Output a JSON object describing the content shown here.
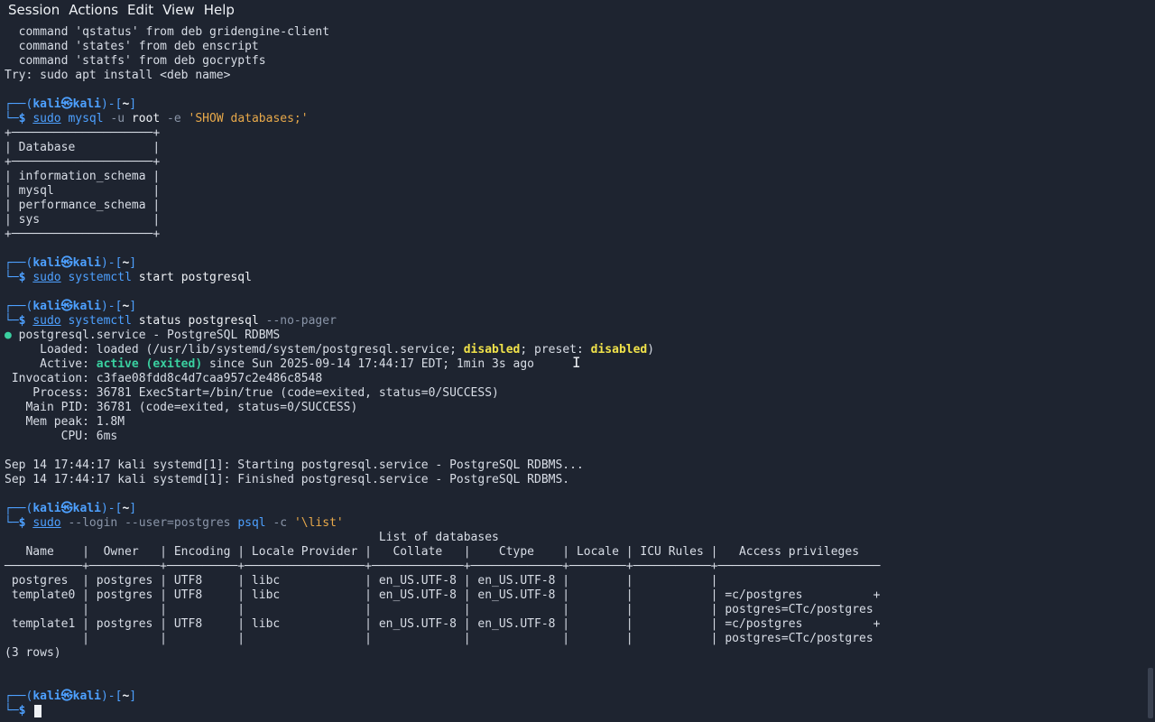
{
  "menubar": {
    "items": [
      "Session",
      "Actions",
      "Edit",
      "View",
      "Help"
    ]
  },
  "terminal": {
    "scrollback": [
      "  command 'qstatus' from deb gridengine-client",
      "  command 'states' from deb enscript",
      "  command 'statfs' from deb gocryptfs",
      "Try: sudo apt install <deb name>"
    ],
    "prompt": {
      "top_open": "┌──(",
      "user": "kali",
      "at": "㉿",
      "host": "kali",
      "close_open": ")-[",
      "path": "~",
      "close": "]",
      "bottom": "└─",
      "dollar": "$"
    },
    "cmd1": {
      "sudo": "sudo",
      "bin": "mysql",
      "opt1": "-u",
      "arg1": "root",
      "opt2": "-e",
      "str": "'SHOW databases;'"
    },
    "mysql_table": {
      "border": "+────────────────────+",
      "header": "| Database           |",
      "rows": [
        "| information_schema |",
        "| mysql              |",
        "| performance_schema |",
        "| sys                |"
      ]
    },
    "cmd2": {
      "sudo": "sudo",
      "bin": "systemctl",
      "args": "start postgresql"
    },
    "cmd3": {
      "sudo": "sudo",
      "bin": "systemctl",
      "args": "status postgresql",
      "opt": "--no-pager"
    },
    "status": {
      "dot": "●",
      "service_line": " postgresql.service - PostgreSQL RDBMS",
      "loaded_pre": "     Loaded: loaded (/usr/lib/systemd/system/postgresql.service; ",
      "loaded_disabled": "disabled",
      "loaded_mid": "; preset: ",
      "loaded_preset": "disabled",
      "loaded_post": ")",
      "active_pre": "     Active: ",
      "active_state": "active (exited)",
      "active_post": " since Sun 2025-09-14 17:44:17 EDT; 1min 3s ago",
      "invocation": " Invocation: c3fae08fdd8c4d7caa957c2e486c8548",
      "process": "    Process: 36781 ExecStart=/bin/true (code=exited, status=0/SUCCESS)",
      "main_pid": "   Main PID: 36781 (code=exited, status=0/SUCCESS)",
      "mem_peak": "   Mem peak: 1.8M",
      "cpu": "        CPU: 6ms"
    },
    "journal": [
      "Sep 14 17:44:17 kali systemd[1]: Starting postgresql.service - PostgreSQL RDBMS...",
      "Sep 14 17:44:17 kali systemd[1]: Finished postgresql.service - PostgreSQL RDBMS."
    ],
    "cmd4": {
      "sudo": "sudo",
      "opt1": "--login",
      "opt2": "--user=postgres",
      "bin": "psql",
      "opt3": "-c",
      "str": "'\\list'"
    },
    "psql": {
      "title": "                                                     List of databases",
      "header": "   Name    |  Owner   | Encoding | Locale Provider |   Collate   |    Ctype    | Locale | ICU Rules |   Access privileges",
      "separator": "───────────+──────────+──────────+─────────────────+─────────────+─────────────+────────+───────────+───────────────────────",
      "rows": [
        " postgres  | postgres | UTF8     | libc            | en_US.UTF-8 | en_US.UTF-8 |        |           |",
        " template0 | postgres | UTF8     | libc            | en_US.UTF-8 | en_US.UTF-8 |        |           | =c/postgres          +",
        "           |          |          |                 |             |             |        |           | postgres=CTc/postgres",
        " template1 | postgres | UTF8     | libc            | en_US.UTF-8 | en_US.UTF-8 |        |           | =c/postgres          +",
        "           |          |          |                 |             |             |        |           | postgres=CTc/postgres"
      ],
      "footer": "(3 rows)"
    }
  },
  "colors": {
    "background": "#1e2430",
    "prompt": "#4da0ff",
    "string": "#e8a94a",
    "warning": "#f0e24a",
    "active": "#3ad0a0"
  }
}
